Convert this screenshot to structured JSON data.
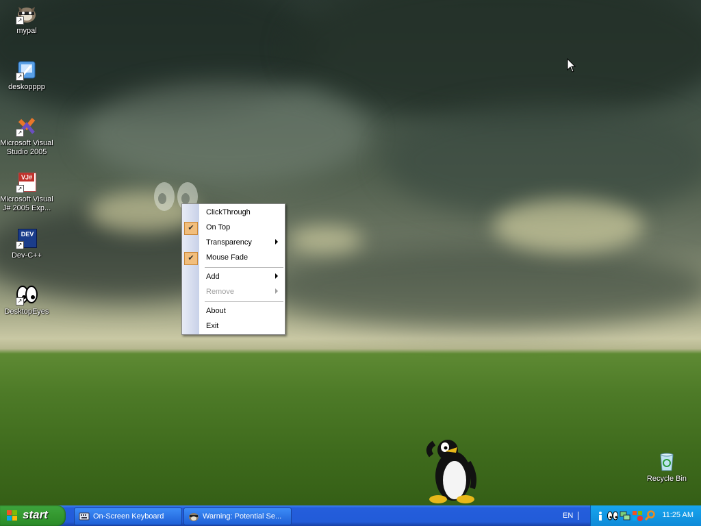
{
  "desktop": {
    "icons": [
      {
        "label": "mypal",
        "icon": "raccoon-icon",
        "shortcut": true
      },
      {
        "label": "deskopppp",
        "icon": "app-icon",
        "shortcut": true
      },
      {
        "label": "Microsoft Visual Studio 2005",
        "icon": "visual-studio-icon",
        "shortcut": true
      },
      {
        "label": "Microsoft Visual J# 2005 Exp...",
        "icon": "vj-sharp-icon",
        "icon_text": "VJ#",
        "shortcut": true
      },
      {
        "label": "Dev-C++",
        "icon": "devcpp-icon",
        "icon_text": "DEV",
        "shortcut": true
      },
      {
        "label": "DesktopEyes",
        "icon": "eyes-icon",
        "shortcut": true
      }
    ],
    "recycle_bin": {
      "label": "Recycle Bin",
      "icon": "recycle-bin-icon"
    }
  },
  "context_menu": {
    "items": [
      {
        "label": "ClickThrough",
        "checked": false,
        "submenu": false,
        "disabled": false
      },
      {
        "label": "On Top",
        "checked": true,
        "submenu": false,
        "disabled": false
      },
      {
        "label": "Transparency",
        "checked": false,
        "submenu": true,
        "disabled": false
      },
      {
        "label": "Mouse Fade",
        "checked": true,
        "submenu": false,
        "disabled": false
      },
      {
        "label": "Add",
        "checked": false,
        "submenu": true,
        "disabled": false
      },
      {
        "label": "Remove",
        "checked": false,
        "submenu": true,
        "disabled": true
      },
      {
        "label": "About",
        "checked": false,
        "submenu": false,
        "disabled": false
      },
      {
        "label": "Exit",
        "checked": false,
        "submenu": false,
        "disabled": false
      }
    ],
    "check_mark": "✔"
  },
  "taskbar": {
    "start_label": "start",
    "tasks": [
      {
        "label": "On-Screen Keyboard",
        "icon": "keyboard-icon"
      },
      {
        "label": "Warning: Potential Se...",
        "icon": "raccoon-icon"
      }
    ],
    "language": "EN",
    "tray_icons": [
      "info-icon",
      "eyes-icon",
      "network-icon",
      "security-icon",
      "search-icon"
    ],
    "clock": "11:25 AM"
  },
  "colors": {
    "taskbar_blue": "#245edc",
    "start_green": "#34982f",
    "tray_blue": "#0e8ad8",
    "menu_check_bg": "#f2be7c"
  }
}
